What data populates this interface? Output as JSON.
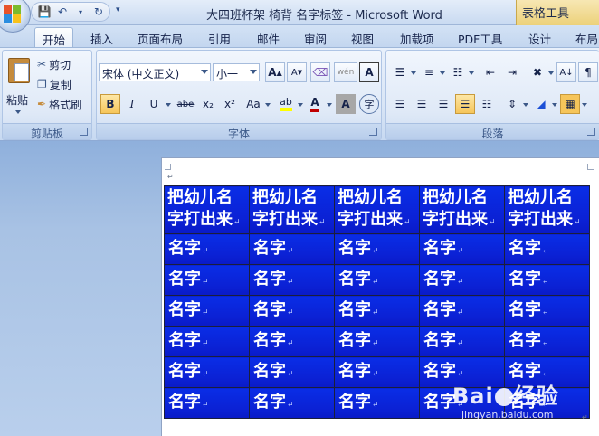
{
  "window": {
    "title": "大四班杯架 椅背 名字标签 - Microsoft Word",
    "context_tab_title": "表格工具"
  },
  "tabs": [
    "开始",
    "插入",
    "页面布局",
    "引用",
    "邮件",
    "审阅",
    "视图",
    "加载项",
    "PDF工具",
    "设计",
    "布局"
  ],
  "ribbon": {
    "clipboard": {
      "label": "剪贴板",
      "paste": "粘贴",
      "cut": "剪切",
      "copy": "复制",
      "format_painter": "格式刷"
    },
    "font": {
      "label": "字体",
      "font_name": "宋体 (中文正文)",
      "font_size": "小一",
      "grow": "A",
      "shrink": "A",
      "bold": "B",
      "italic": "I",
      "underline": "U",
      "strike": "abe",
      "subscript": "x₂",
      "superscript": "x²",
      "change_case": "Aa",
      "highlight": "ab",
      "font_color": "A",
      "char_shading": "A",
      "enclose": "字",
      "wen": "wén"
    },
    "paragraph": {
      "label": "段落"
    }
  },
  "document": {
    "header_cell_text": "把幼儿名字打出来",
    "header_cell_line1": "把幼儿名",
    "header_cell_line2": "字打出来",
    "body_cell_text": "名字",
    "columns": 5,
    "body_rows": 6,
    "cell_color": "#0b21d4"
  },
  "watermark": {
    "brand": "Bai",
    "brand_suffix": "经验",
    "url": "jingyan.baidu.com"
  }
}
